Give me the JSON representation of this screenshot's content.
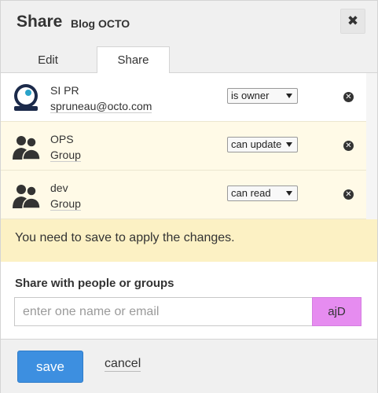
{
  "dialog": {
    "title": "Share",
    "subtitle": "Blog OCTO",
    "close_label": "✖"
  },
  "tabs": [
    {
      "label": "Edit",
      "active": false
    },
    {
      "label": "Share",
      "active": true
    }
  ],
  "members": [
    {
      "name": "SI PR",
      "detail": "spruneau@octo.com",
      "role": "is owner",
      "avatar": "user-photo-icon"
    },
    {
      "name": "OPS",
      "detail": "Group",
      "role": "can update",
      "avatar": "group-icon"
    },
    {
      "name": "dev",
      "detail": "Group",
      "role": "can read",
      "avatar": "group-icon"
    }
  ],
  "notice": "You need to save to apply the changes.",
  "share_section": {
    "title": "Share with people or groups",
    "placeholder": "enter one name or email",
    "addon_label": "ajD"
  },
  "footer": {
    "save_label": "save",
    "cancel_label": "cancel"
  },
  "colors": {
    "notice_bg": "#fcf1c4",
    "row_highlight": "#fffae7",
    "primary": "#3d8fe0",
    "addon": "#e68cf0"
  }
}
